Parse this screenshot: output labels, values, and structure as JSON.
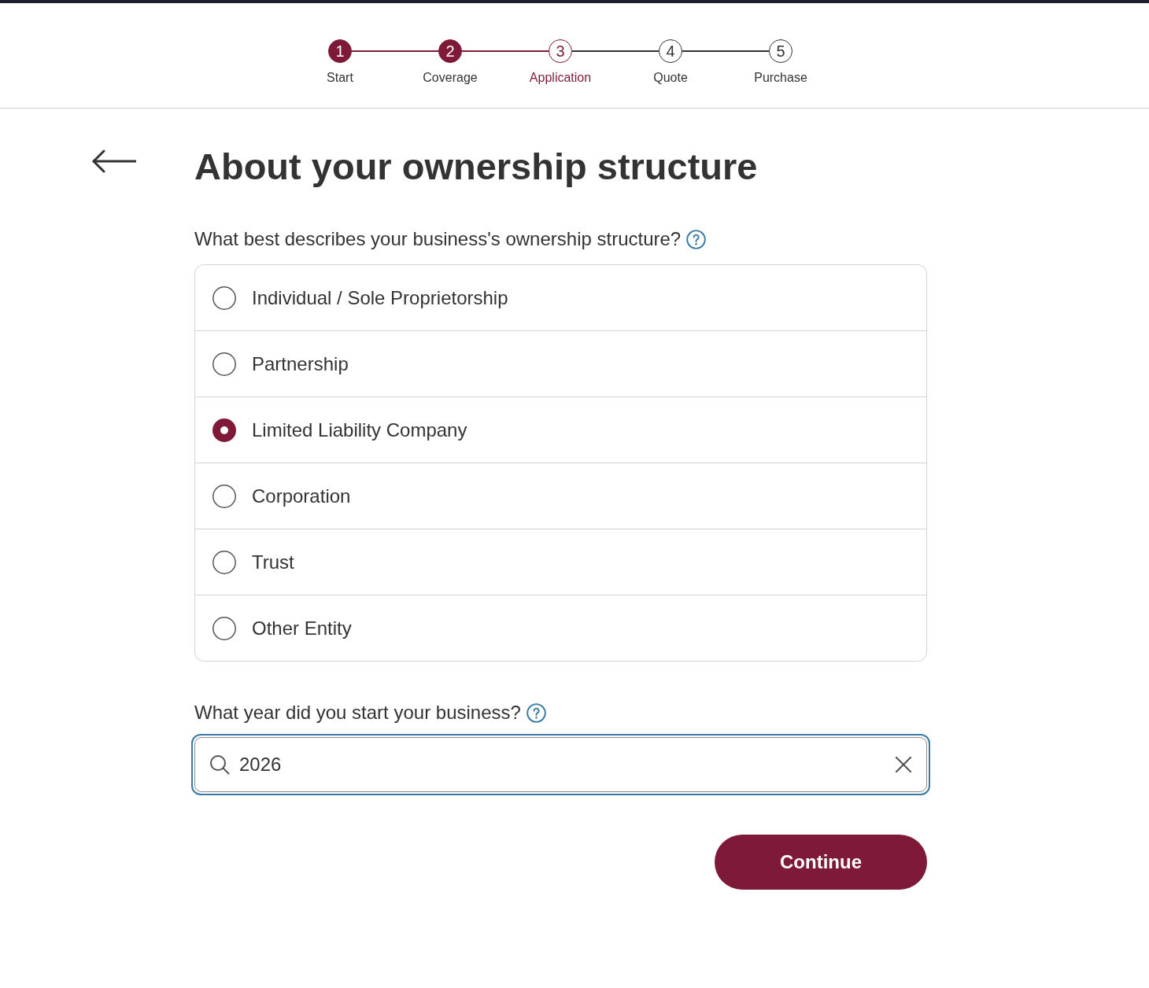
{
  "progress": {
    "steps": [
      {
        "number": "1",
        "label": "Start",
        "completed": true,
        "current": false
      },
      {
        "number": "2",
        "label": "Coverage",
        "completed": true,
        "current": false
      },
      {
        "number": "3",
        "label": "Application",
        "completed": false,
        "current": true
      },
      {
        "number": "4",
        "label": "Quote",
        "completed": false,
        "current": false
      },
      {
        "number": "5",
        "label": "Purchase",
        "completed": false,
        "current": false
      }
    ]
  },
  "heading": "About your ownership structure",
  "ownership_question": {
    "label": "What best describes your business's ownership structure?",
    "options": [
      {
        "label": "Individual / Sole Proprietorship",
        "selected": false
      },
      {
        "label": "Partnership",
        "selected": false
      },
      {
        "label": "Limited Liability Company",
        "selected": true
      },
      {
        "label": "Corporation",
        "selected": false
      },
      {
        "label": "Trust",
        "selected": false
      },
      {
        "label": "Other Entity",
        "selected": false
      }
    ]
  },
  "year_question": {
    "label": "What year did you start your business?",
    "field": {
      "value": "2026",
      "focused": true
    }
  },
  "continue_button": "Continue"
}
